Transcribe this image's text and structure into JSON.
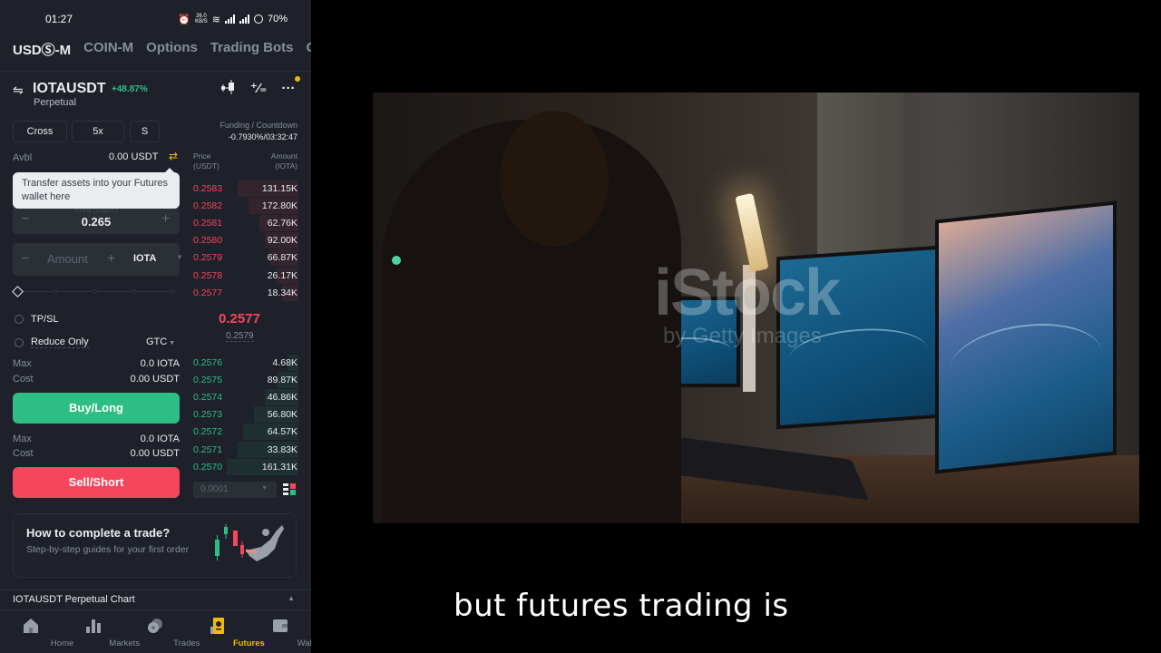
{
  "status_bar": {
    "time": "01:27",
    "net_speed_value": "26.0",
    "net_speed_unit": "KB/S",
    "battery": "70%"
  },
  "top_tabs": [
    {
      "label": "USDⓈ-M",
      "active": true
    },
    {
      "label": "COIN-M",
      "active": false
    },
    {
      "label": "Options",
      "active": false
    },
    {
      "label": "Trading Bots",
      "active": false
    },
    {
      "label": "C",
      "active": false
    }
  ],
  "pair": {
    "symbol": "IOTAUSDT",
    "change": "+48.87%",
    "type": "Perpetual"
  },
  "header_icons": [
    "candlestick-chart-icon",
    "percent-calculator-icon",
    "more-icon"
  ],
  "order_settings": {
    "margin_mode": "Cross",
    "leverage": "5x",
    "asset_mode": "S"
  },
  "funding": {
    "label": "Funding / Countdown",
    "value": "-0.7930%/03:32:47"
  },
  "available": {
    "label": "Avbl",
    "value": "0.00 USDT"
  },
  "tooltip": {
    "text": "Transfer assets into your Futures wallet here"
  },
  "price_input": {
    "label": "Price (USDT)",
    "value": "0.265",
    "minus": "−",
    "plus": "+"
  },
  "amount_input": {
    "placeholder": "Amount",
    "unit": "IOTA",
    "minus": "−",
    "plus": "+"
  },
  "options": {
    "tpsl_label": "TP/SL",
    "reduce_only_label": "Reduce Only",
    "time_in_force": "GTC"
  },
  "buy_summary": {
    "max_label": "Max",
    "max_value": "0.0 IOTA",
    "cost_label": "Cost",
    "cost_value": "0.00 USDT",
    "button": "Buy/Long"
  },
  "sell_summary": {
    "max_label": "Max",
    "max_value": "0.0 IOTA",
    "cost_label": "Cost",
    "cost_value": "0.00 USDT",
    "button": "Sell/Short"
  },
  "order_book": {
    "price_header_1": "Price",
    "price_header_2": "(USDT)",
    "amount_header_1": "Amount",
    "amount_header_2": "(IOTA)",
    "asks": [
      {
        "price": "0.2583",
        "amount": "131.15K",
        "depth": 0.55
      },
      {
        "price": "0.2582",
        "amount": "172.80K",
        "depth": 0.45
      },
      {
        "price": "0.2581",
        "amount": "62.76K",
        "depth": 0.35
      },
      {
        "price": "0.2580",
        "amount": "92.00K",
        "depth": 0.3
      },
      {
        "price": "0.2579",
        "amount": "66.87K",
        "depth": 0.25
      },
      {
        "price": "0.2578",
        "amount": "26.17K",
        "depth": 0.2
      },
      {
        "price": "0.2577",
        "amount": "18.34K",
        "depth": 0.15
      }
    ],
    "last_price": "0.2577",
    "mark_price": "0.2579",
    "bids": [
      {
        "price": "0.2576",
        "amount": "4.68K",
        "depth": 0.1
      },
      {
        "price": "0.2575",
        "amount": "89.87K",
        "depth": 0.2
      },
      {
        "price": "0.2574",
        "amount": "46.86K",
        "depth": 0.3
      },
      {
        "price": "0.2573",
        "amount": "56.80K",
        "depth": 0.4
      },
      {
        "price": "0.2572",
        "amount": "64.57K",
        "depth": 0.5
      },
      {
        "price": "0.2571",
        "amount": "33.83K",
        "depth": 0.55
      },
      {
        "price": "0.2570",
        "amount": "161.31K",
        "depth": 0.65
      }
    ],
    "tick_size": "0.0001"
  },
  "guide_card": {
    "title": "How to complete a trade?",
    "subtitle": "Step-by-step guides for your first order"
  },
  "chart_section": {
    "title": "IOTAUSDT Perpetual  Chart"
  },
  "bottom_nav": [
    {
      "label": "Home",
      "icon": "home-icon",
      "active": false
    },
    {
      "label": "Markets",
      "icon": "markets-icon",
      "active": false
    },
    {
      "label": "Trades",
      "icon": "trades-icon",
      "active": false
    },
    {
      "label": "Futures",
      "icon": "futures-icon",
      "active": true
    },
    {
      "label": "Wallets",
      "icon": "wallet-icon",
      "active": false
    }
  ],
  "video": {
    "watermark": "iStock",
    "watermark_sub": "by Getty Images",
    "caption": "but futures trading is"
  },
  "colors": {
    "bg": "#1e2129",
    "buy": "#2ebd85",
    "sell": "#f6465d",
    "accent": "#f0b90b"
  }
}
